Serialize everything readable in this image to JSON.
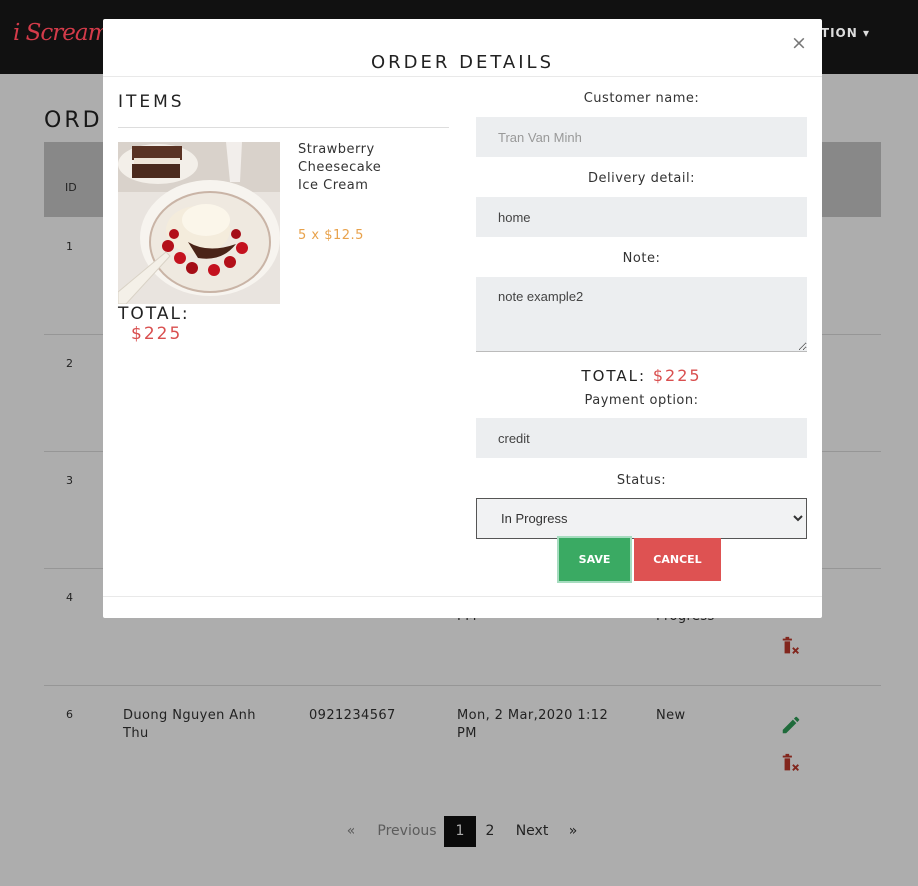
{
  "navbar": {
    "logo": "i Scream",
    "right_label": "CTION ▾"
  },
  "page": {
    "heading": "ORDI",
    "table_head_id": "ID",
    "row_ids": [
      "1",
      "2",
      "3",
      "4",
      "6"
    ],
    "rows": [
      {
        "id": "4",
        "date_tail": "PM",
        "status_tail": "Progress"
      },
      {
        "id": "6",
        "name": "Duong Nguyen Anh Thu",
        "phone": "0921234567",
        "date": "Mon, 2 Mar,2020 1:12 PM",
        "status": "New"
      }
    ]
  },
  "pagination": {
    "first": "«",
    "previous": "Previous",
    "pages": [
      "1",
      "2"
    ],
    "active": "1",
    "next": "Next",
    "last": "»"
  },
  "modal": {
    "title": "ORDER DETAILS",
    "close": "×",
    "items_title": "ITEMS",
    "items": [
      {
        "name": "Strawberry Cheesecake Ice Cream",
        "qty_price": "5 x $12.5"
      }
    ],
    "left_total_label": "TOTAL:",
    "left_total_value": "$225",
    "form": {
      "customer_label": "Customer name:",
      "customer_placeholder": "Tran Van Minh",
      "delivery_label": "Delivery detail:",
      "delivery_value": "home",
      "note_label": "Note:",
      "note_value": "note example2",
      "total_label": "TOTAL:",
      "total_value": "$225",
      "payment_label": "Payment option:",
      "payment_value": "credit",
      "status_label": "Status:",
      "status_value": "In Progress"
    },
    "save_label": "SAVE",
    "cancel_label": "CANCEL"
  },
  "colors": {
    "accent_red": "#d94f4f",
    "save_green": "#3aaa63",
    "price_orange": "#e8a24c",
    "icon_green": "#2e9e57",
    "icon_red": "#c0392b"
  }
}
